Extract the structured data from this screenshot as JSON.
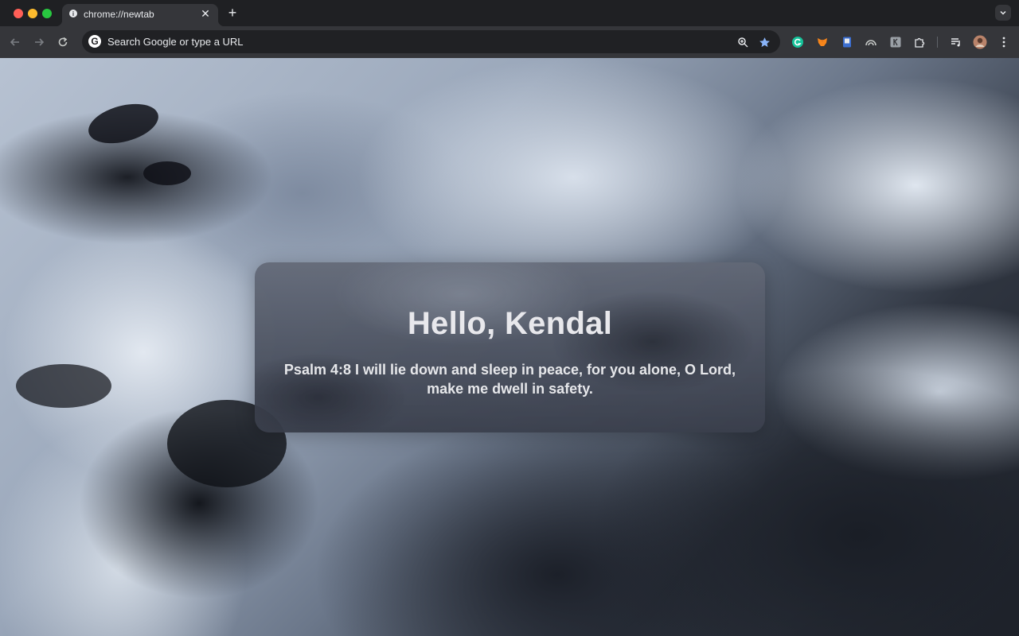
{
  "tab": {
    "title": "chrome://newtab",
    "favicon": "chrome-info-icon",
    "close_glyph": "✕",
    "new_tab_glyph": "+"
  },
  "toolbar": {
    "omnibox_placeholder": "Search Google or type a URL",
    "bookmark_star_color": "#8ab4f8"
  },
  "extensions": [
    {
      "name": "grammarly-icon",
      "color": "#15c39a"
    },
    {
      "name": "metamask-icon",
      "color": "#f6851b"
    },
    {
      "name": "bookmark-extension-icon",
      "color": "#8ab4f8"
    },
    {
      "name": "wave-extension-icon",
      "color": "#c4c7c5"
    },
    {
      "name": "k-extension-icon",
      "color": "#9aa0a6"
    },
    {
      "name": "puzzle-extensions-icon",
      "color": "#e8eaed"
    }
  ],
  "greeting": {
    "title": "Hello, Kendal",
    "verse": "Psalm 4:8 I will lie down and sleep in peace, for you alone, O Lord, make me dwell in safety."
  }
}
